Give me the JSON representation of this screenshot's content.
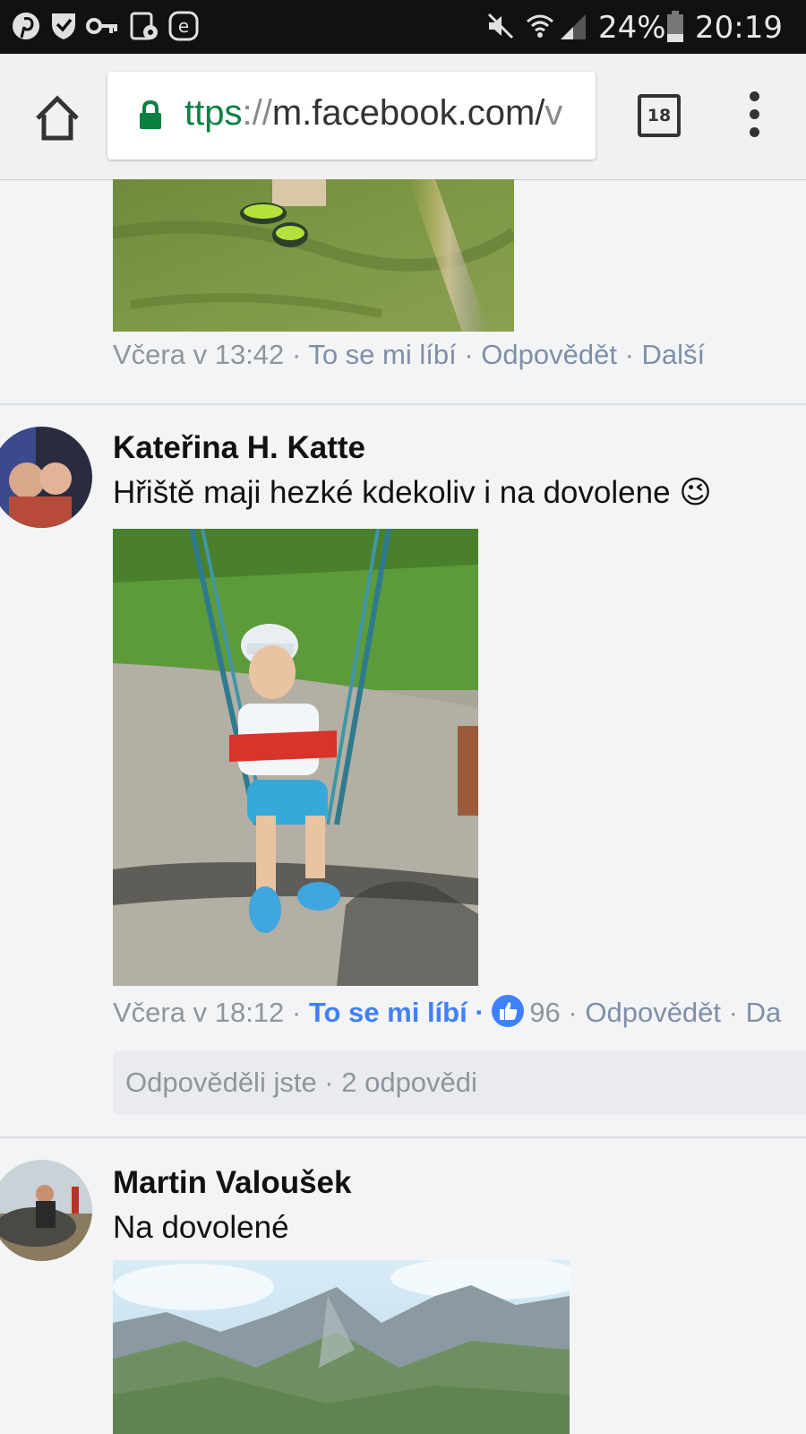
{
  "status_bar": {
    "battery": "24%",
    "time": "20:19"
  },
  "browser": {
    "url_scheme": "ttps",
    "url_sep": "://",
    "url_host": "m.facebook.com/",
    "url_trail": "v",
    "tab_count": "18"
  },
  "comments": [
    {
      "time": "Včera v 13:42",
      "like": "To se mi líbí",
      "reply": "Odpovědět",
      "more": "Další"
    },
    {
      "author": "Kateřina H. Katte",
      "text": "Hřiště maji hezké kdekoliv i na dovolene",
      "emoji": "😉",
      "time": "Včera v 18:12",
      "like": "To se mi líbí",
      "like_count": "96",
      "reply": "Odpovědět",
      "more": "Da",
      "replies_summary": "Odpověděli jste · 2 odpovědi"
    },
    {
      "author": "Martin Valoušek",
      "text": "Na dovolené"
    }
  ],
  "separator": "·"
}
